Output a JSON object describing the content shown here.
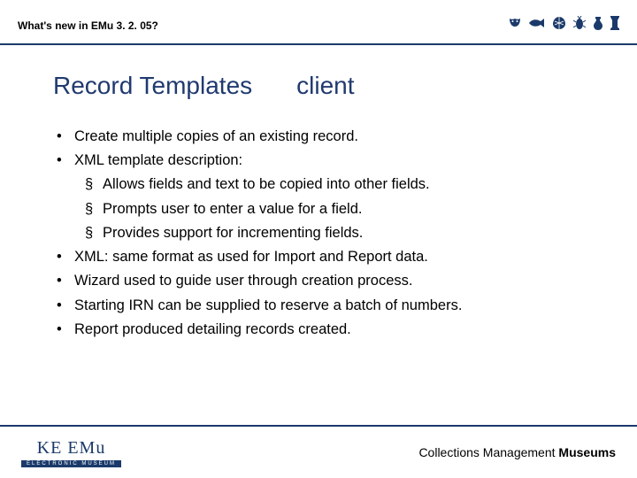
{
  "header": {
    "title": "What's new in EMu 3. 2. 05?"
  },
  "slide": {
    "title_left": "Record Templates",
    "title_right": "client"
  },
  "bullets": [
    {
      "text": "Create multiple copies of an existing record."
    },
    {
      "text": "XML template description:",
      "sub": [
        "Allows fields and text to be copied into other fields.",
        "Prompts user to enter a value for a field.",
        "Provides support for incrementing fields."
      ]
    },
    {
      "text": "XML: same format as used for Import and Report data."
    },
    {
      "text": "Wizard used to guide user through creation process."
    },
    {
      "text": "Starting IRN can be supplied to reserve a batch of numbers."
    },
    {
      "text": "Report produced detailing records created."
    }
  ],
  "footer": {
    "logo_main": "KE EMu",
    "logo_sub": "ELECTRONIC MUSEUM",
    "text_normal": "Collections Management ",
    "text_bold": "Museums"
  }
}
